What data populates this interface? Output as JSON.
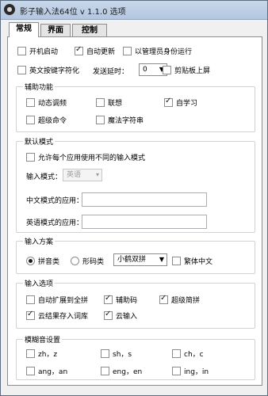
{
  "window": {
    "title": "影子输入法64位 v 1.1.0 选项",
    "icon": "shadow-input-logo"
  },
  "tabs": [
    {
      "label": "常规",
      "active": true
    },
    {
      "label": "界面",
      "active": false
    },
    {
      "label": "控制",
      "active": false
    }
  ],
  "general": {
    "autostart": {
      "label": "开机启动",
      "checked": false
    },
    "autoupdate": {
      "label": "自动更新",
      "checked": true
    },
    "run_as_admin": {
      "label": "以管理员身份运行",
      "checked": false
    },
    "english_punct": {
      "label": "英文按键字符化",
      "checked": false
    },
    "send_delay_label": "发送延时：",
    "send_delay_value": "0",
    "clipboard_screen": {
      "label": "剪贴板上屏",
      "checked": false
    }
  },
  "assist": {
    "title": "辅助功能",
    "items": [
      {
        "label": "动态调频",
        "checked": false
      },
      {
        "label": "联想",
        "checked": false
      },
      {
        "label": "自学习",
        "checked": true
      },
      {
        "label": "超级命令",
        "checked": false
      },
      {
        "label": "魔法字符串",
        "checked": false
      }
    ]
  },
  "default_mode": {
    "title": "默认模式",
    "per_app": {
      "label": "允许每个应用使用不同的输入模式",
      "checked": false
    },
    "input_mode_label": "输入模式：",
    "input_mode_value": "英语",
    "chinese_apps_label": "中文模式的应用：",
    "chinese_apps_value": "",
    "english_apps_label": "英语模式的应用：",
    "english_apps_value": ""
  },
  "scheme": {
    "title": "输入方案",
    "pinyin": {
      "label": "拼音类",
      "selected": true
    },
    "shape": {
      "label": "形码类",
      "selected": false
    },
    "scheme_value": "小鹤双拼",
    "traditional": {
      "label": "繁体中文",
      "checked": false
    }
  },
  "input_options": {
    "title": "输入选项",
    "items": [
      {
        "label": "自动扩展到全拼",
        "checked": false
      },
      {
        "label": "辅助码",
        "checked": true
      },
      {
        "label": "超级简拼",
        "checked": true
      },
      {
        "label": "云结果存入词库",
        "checked": true
      },
      {
        "label": "云输入",
        "checked": true
      }
    ]
  },
  "fuzzy": {
    "title": "模糊音设置",
    "items": [
      {
        "label": "zh，z",
        "checked": false
      },
      {
        "label": "sh，s",
        "checked": false
      },
      {
        "label": "ch，c",
        "checked": false
      },
      {
        "label": "ang，an",
        "checked": false
      },
      {
        "label": "eng，en",
        "checked": false
      },
      {
        "label": "ing，in",
        "checked": false
      }
    ]
  }
}
